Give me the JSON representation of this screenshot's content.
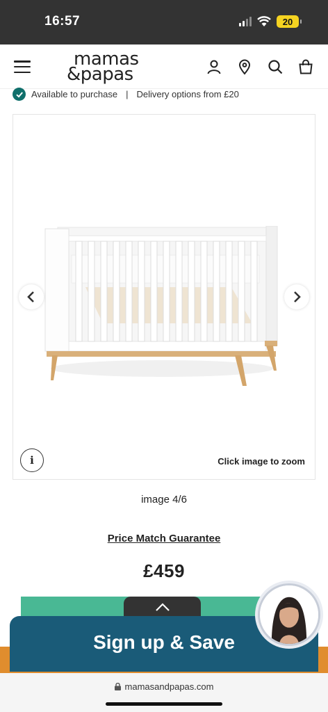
{
  "status_bar": {
    "time": "16:57",
    "battery": "20"
  },
  "header": {
    "logo_line1": "mamas",
    "logo_line2": "&papas"
  },
  "availability": {
    "text": "Available to purchase",
    "separator": "|",
    "delivery": "Delivery options from £20"
  },
  "gallery": {
    "zoom_hint": "Click image to zoom",
    "info_label": "i",
    "counter": "image 4/6",
    "image_subject": "white cot with wooden legs"
  },
  "product": {
    "price_match": "Price Match Guarantee",
    "price": "£459"
  },
  "signup": {
    "label": "Sign up & Save"
  },
  "browser": {
    "url": "mamasandpapas.com"
  },
  "colors": {
    "status_bar": "#333333",
    "check": "#0f6f6b",
    "teal_button": "#49b894",
    "signup_banner": "#1a5b78",
    "orange_strip": "#e08d2e"
  }
}
